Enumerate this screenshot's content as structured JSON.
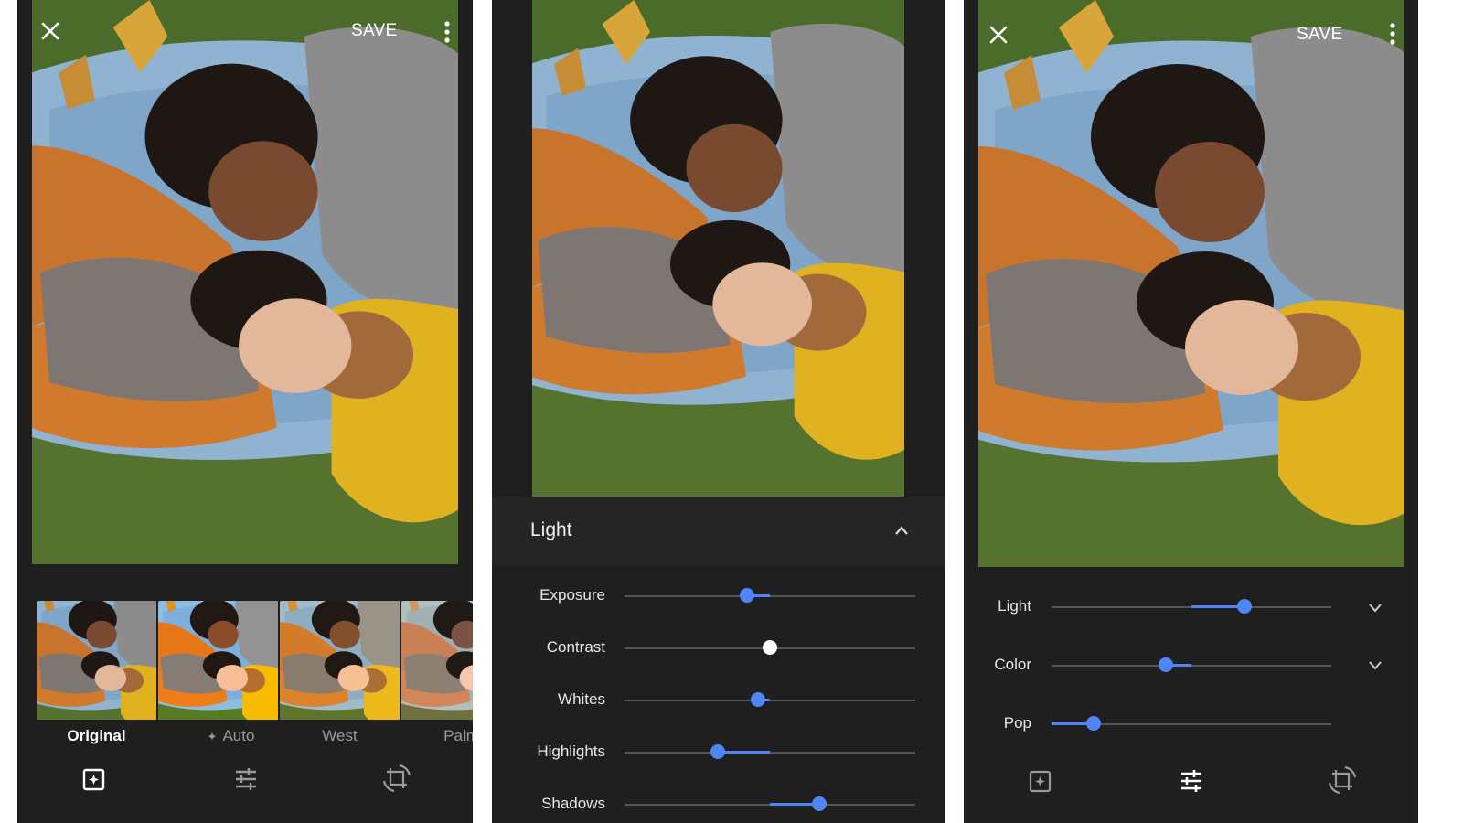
{
  "panel1": {
    "save_label": "SAVE",
    "filters": [
      {
        "label": "Original",
        "selected": true
      },
      {
        "label": "Auto",
        "selected": false
      },
      {
        "label": "West",
        "selected": false
      },
      {
        "label": "Palm",
        "selected": false
      }
    ],
    "auto_sparkle_icon": "sparkle-icon"
  },
  "panel2": {
    "section_title": "Light",
    "sliders": [
      {
        "label": "Exposure",
        "value": 0.42,
        "origin": 0.5
      },
      {
        "label": "Contrast",
        "value": 0.5,
        "origin": 0.5
      },
      {
        "label": "Whites",
        "value": 0.46,
        "origin": 0.5
      },
      {
        "label": "Highlights",
        "value": 0.32,
        "origin": 0.5
      },
      {
        "label": "Shadows",
        "value": 0.67,
        "origin": 0.5
      }
    ]
  },
  "panel3": {
    "save_label": "SAVE",
    "sliders": [
      {
        "label": "Light",
        "value": 0.69,
        "origin": 0.5
      },
      {
        "label": "Color",
        "value": 0.41,
        "origin": 0.5
      },
      {
        "label": "Pop",
        "value": 0.15,
        "origin": 0.0
      }
    ]
  },
  "colors": {
    "accent": "#4f86f7",
    "background": "#1f1f1f",
    "panel_header": "#252525"
  }
}
